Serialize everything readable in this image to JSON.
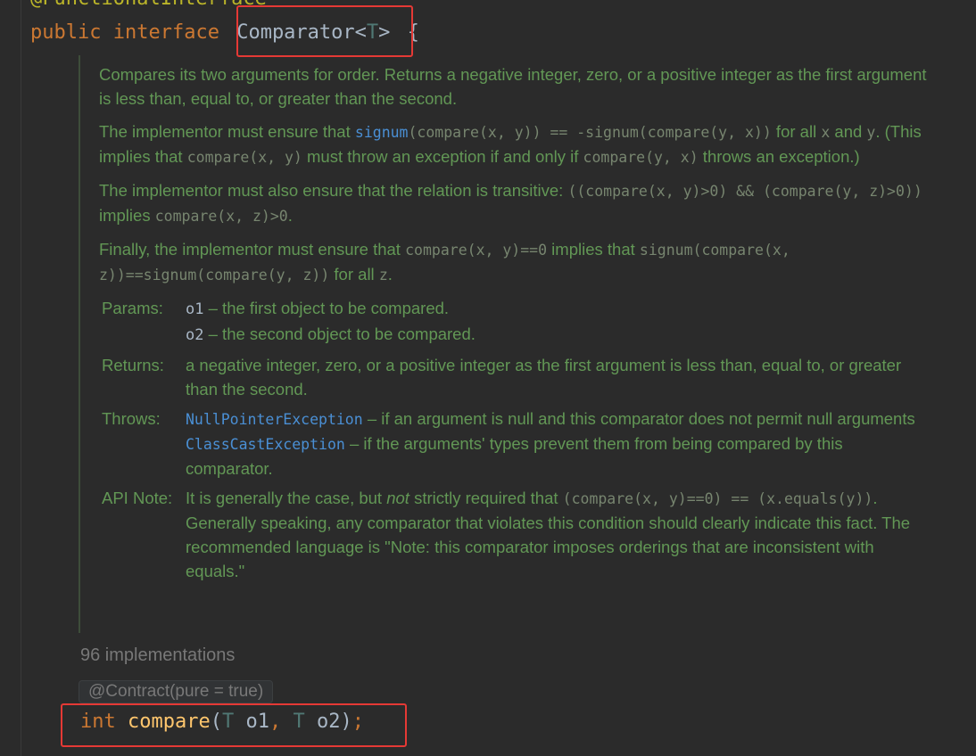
{
  "editor": {
    "top_annotation": "@FunctionalInterface",
    "decl": {
      "kw1": "public",
      "kw2": "interface",
      "name": "Comparator",
      "lt": "<",
      "type_param": "T",
      "gt": ">",
      "brace": "{"
    },
    "doc": {
      "p1": "Compares its two arguments for order. Returns a negative integer, zero, or a positive integer as the first argument is less than, equal to, or greater than the second.",
      "p2": {
        "t1": "The implementor must ensure that ",
        "link_signum": "signum",
        "code1": "(compare(x, y)) == -signum(compare(y, x))",
        "t2": " for all ",
        "code_x": "x",
        "t3": " and ",
        "code_y": "y",
        "t4": ". (This implies that ",
        "code2": "compare(x, y)",
        "t5": " must throw an exception if and only if ",
        "code3": "compare(y, x)",
        "t6": " throws an exception.)"
      },
      "p3": {
        "t1": "The implementor must also ensure that the relation is transitive: ",
        "code1": "((compare(x, y)>0) && (compare(y, z)>0))",
        "t2": " implies ",
        "code2": "compare(x, z)>0",
        "t3": "."
      },
      "p4": {
        "t1": "Finally, the implementor must ensure that ",
        "code1": "compare(x, y)==0",
        "t2": " implies that ",
        "code2": "signum(compare(x, z))==signum(compare(y, z))",
        "t3": " for all ",
        "code_z": "z",
        "t4": "."
      },
      "params_label": "Params:",
      "param1_name": "o1",
      "param1_desc": " – the first object to be compared.",
      "param2_name": "o2",
      "param2_desc": " – the second object to be compared.",
      "returns_label": "Returns:",
      "returns_text": "a negative integer, zero, or a positive integer as the first argument is less than, equal to, or greater than the second.",
      "throws_label": "Throws:",
      "throws1_name": "NullPointerException",
      "throws1_desc": " – if an argument is null and this comparator does not permit null arguments",
      "throws2_name": "ClassCastException",
      "throws2_desc": " – if the arguments' types prevent them from being compared by this comparator.",
      "apinote_label": "API Note:",
      "apinote": {
        "t1": "It is generally the case, but ",
        "em": "not",
        "t2": " strictly required that ",
        "code1": "(compare(x, y)==0) == (x.equals(y))",
        "t3": ". Generally speaking, any comparator that violates this condition should clearly indicate this fact. The recommended language is \"Note: this comparator imposes orderings that are inconsistent with equals.\""
      }
    },
    "implementations": "96 implementations",
    "contract": "@Contract(pure = true)",
    "method": {
      "ret": "int",
      "name": "compare",
      "open": "(",
      "t1": "T",
      "p1": " o1",
      "comma": ",",
      "t2": " T",
      "p2": " o2",
      "close": ")",
      "semi": ";"
    }
  }
}
